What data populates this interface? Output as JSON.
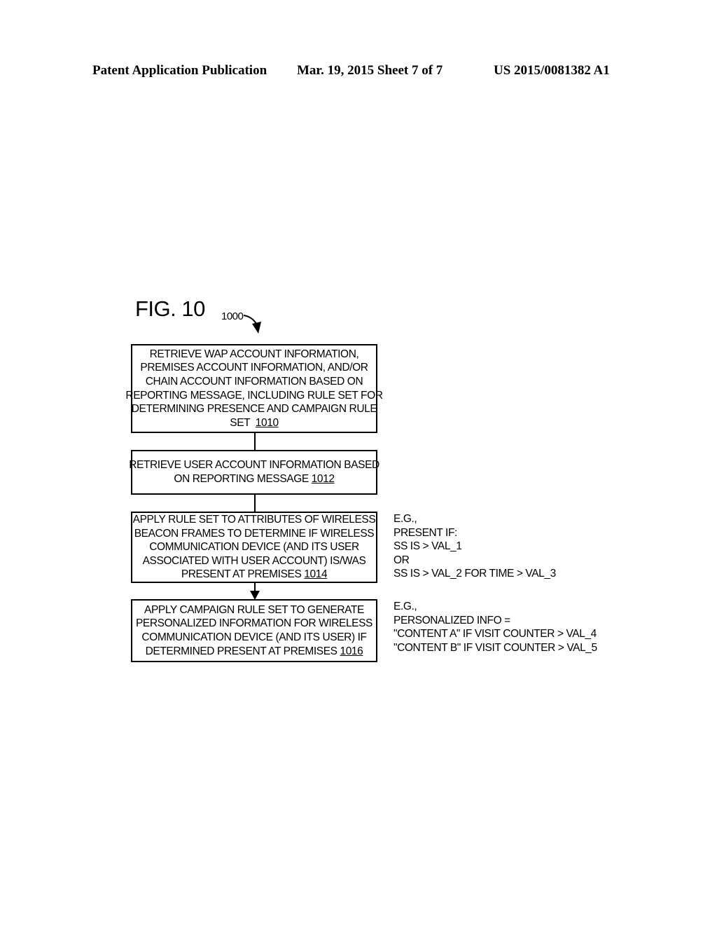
{
  "header": {
    "publication": "Patent Application Publication",
    "date_sheet": "Mar. 19, 2015  Sheet 7 of 7",
    "patent_number": "US 2015/0081382 A1"
  },
  "figure": {
    "label": "FIG. 10",
    "reference_number": "1000",
    "reference_icon": "curved-arrow-down-icon"
  },
  "flowchart": {
    "steps": [
      {
        "lines": [
          "RETRIEVE WAP ACCOUNT INFORMATION,",
          "PREMISES ACCOUNT INFORMATION, AND/OR",
          "CHAIN ACCOUNT INFORMATION BASED ON",
          "REPORTING MESSAGE, INCLUDING RULE SET FOR",
          "DETERMINING PRESENCE AND CAMPAIGN RULE",
          "SET "
        ],
        "ref": "1010"
      },
      {
        "lines": [
          "RETRIEVE USER ACCOUNT INFORMATION BASED",
          "ON REPORTING MESSAGE "
        ],
        "ref": "1012"
      },
      {
        "lines": [
          "APPLY RULE SET TO ATTRIBUTES OF WIRELESS",
          "BEACON FRAMES TO DETERMINE IF WIRELESS",
          "COMMUNICATION DEVICE (AND ITS USER",
          "ASSOCIATED WITH USER ACCOUNT) IS/WAS",
          "PRESENT AT PREMISES "
        ],
        "ref": "1014"
      },
      {
        "lines": [
          "APPLY CAMPAIGN RULE SET TO GENERATE",
          "PERSONALIZED INFORMATION FOR WIRELESS",
          "COMMUNICATION DEVICE (AND ITS USER) IF",
          "DETERMINED PRESENT AT PREMISES "
        ],
        "ref": "1016"
      }
    ]
  },
  "notes": {
    "presence": [
      "E.G.,",
      "PRESENT IF:",
      "SS IS > VAL_1",
      "OR",
      "SS IS > VAL_2 FOR TIME > VAL_3"
    ],
    "campaign": [
      "E.G.,",
      "PERSONALIZED INFO =",
      "\"CONTENT A\" IF VISIT COUNTER > VAL_4",
      "\"CONTENT B\" IF VISIT COUNTER > VAL_5"
    ]
  }
}
